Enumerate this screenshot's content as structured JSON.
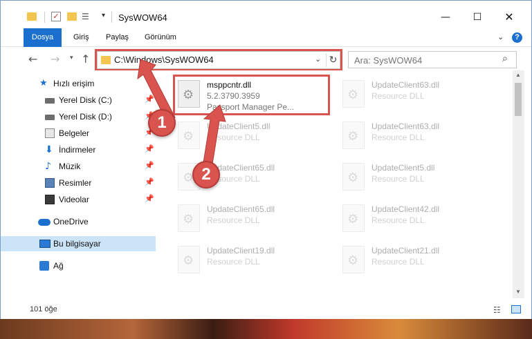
{
  "window": {
    "title": "SysWOW64",
    "minimize": "—",
    "maximize": "☐",
    "close": "✕"
  },
  "ribbon": {
    "tabs": [
      "Dosya",
      "Giriş",
      "Paylaş",
      "Görünüm"
    ],
    "help": "?"
  },
  "address": {
    "path": "C:\\Windows\\SysWOW64",
    "refresh": "↻"
  },
  "search": {
    "placeholder": "Ara: SysWOW64"
  },
  "sidebar": {
    "items": [
      {
        "label": "Hızlı erişim"
      },
      {
        "label": "Yerel Disk (C:)"
      },
      {
        "label": "Yerel Disk (D:)"
      },
      {
        "label": "Belgeler"
      },
      {
        "label": "İndirmeler"
      },
      {
        "label": "Müzik"
      },
      {
        "label": "Resimler"
      },
      {
        "label": "Videolar"
      },
      {
        "label": "OneDrive"
      },
      {
        "label": "Bu bilgisayar"
      },
      {
        "label": "Ağ"
      }
    ]
  },
  "files": [
    {
      "name": "msppcntr.dll",
      "line2": "5.2.3790.3959",
      "line3": "Passport Manager Pe..."
    },
    {
      "name": "UpdateClient63.dll",
      "line2": "Resource DLL"
    },
    {
      "name": "UpdateClient5.dll",
      "line2": "Resource DLL"
    },
    {
      "name": "UpdateClient63.dll",
      "line2": "Resource DLL"
    },
    {
      "name": "UpdateClient65.dll",
      "line2": "Resource DLL"
    },
    {
      "name": "UpdateClient5.dll",
      "line2": "Resource DLL"
    },
    {
      "name": "UpdateClient65.dll",
      "line2": "Resource DLL"
    },
    {
      "name": "UpdateClient42.dll",
      "line2": "Resource DLL"
    },
    {
      "name": "UpdateClient19.dll",
      "line2": "Resource DLL"
    },
    {
      "name": "UpdateClient21.dll",
      "line2": "Resource DLL"
    }
  ],
  "status": {
    "count": "101 öğe"
  },
  "annotations": {
    "step1": "1",
    "step2": "2",
    "color": "#d9534f"
  },
  "colors": {
    "accent": "#1a6fcf",
    "highlight": "#d9534f",
    "selected": "#cce4f7"
  }
}
